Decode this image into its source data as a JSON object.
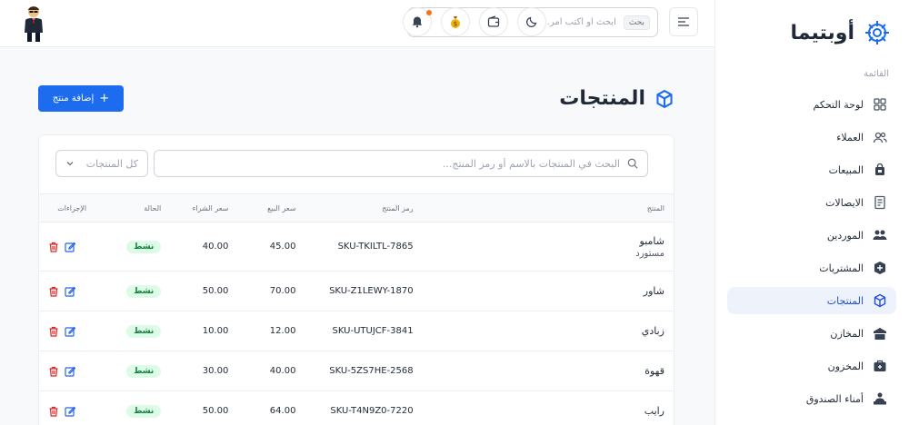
{
  "brand": {
    "name": "أوبتيما"
  },
  "sidebar": {
    "heading": "القائمة",
    "items": [
      {
        "label": "لوحة التحكم",
        "icon": "dashboard-icon"
      },
      {
        "label": "العملاء",
        "icon": "users-icon"
      },
      {
        "label": "المبيعات",
        "icon": "shopping-bag-icon"
      },
      {
        "label": "الايصالات",
        "icon": "receipt-icon"
      },
      {
        "label": "الموردين",
        "icon": "suppliers-icon"
      },
      {
        "label": "المشتريات",
        "icon": "purchases-icon"
      },
      {
        "label": "المنتجات",
        "icon": "box-icon",
        "active": true
      },
      {
        "label": "المخازن",
        "icon": "warehouse-icon"
      },
      {
        "label": "المخزون",
        "icon": "inventory-icon"
      },
      {
        "label": "أمناء الصندوق",
        "icon": "cashiers-icon"
      }
    ]
  },
  "topbar": {
    "search_placeholder": "ابحث أو اكتب أمر...",
    "search_shortcut": "بحث",
    "notification_dot_color": "#f97316"
  },
  "page": {
    "title": "المنتجات",
    "add_button": "إضافة منتج",
    "table_search_placeholder": "البحث في المنتجات بالاسم أو رمز المنتج...",
    "filter_selected": "كل المنتجات"
  },
  "table": {
    "headers": {
      "product": "المنتج",
      "sku": "رمز المنتج",
      "sale_price": "سعر البيع",
      "purchase_price": "سعر الشراء",
      "status": "الحالة",
      "actions": "الإجراءات"
    },
    "rows": [
      {
        "name": "شامبو",
        "sub": "مستورد",
        "sku": "SKU-TKILTL-7865",
        "sale": "45.00",
        "purchase": "40.00",
        "status": "نشط"
      },
      {
        "name": "شاور",
        "sub": "",
        "sku": "SKU-Z1LEWY-1870",
        "sale": "70.00",
        "purchase": "50.00",
        "status": "نشط"
      },
      {
        "name": "زبادي",
        "sub": "",
        "sku": "SKU-UTUJCF-3841",
        "sale": "12.00",
        "purchase": "10.00",
        "status": "نشط"
      },
      {
        "name": "قهوة",
        "sub": "",
        "sku": "SKU-5ZS7HE-2568",
        "sale": "40.00",
        "purchase": "30.00",
        "status": "نشط"
      },
      {
        "name": "رايب",
        "sub": "",
        "sku": "SKU-T4N9Z0-7220",
        "sale": "64.00",
        "purchase": "50.00",
        "status": "نشط"
      }
    ]
  },
  "colors": {
    "primary": "#1d6cf0",
    "active_bg": "#eef2fb",
    "badge_bg": "#dcfce7",
    "badge_text": "#15803d",
    "delete": "#dc2626",
    "edit": "#2563eb"
  }
}
